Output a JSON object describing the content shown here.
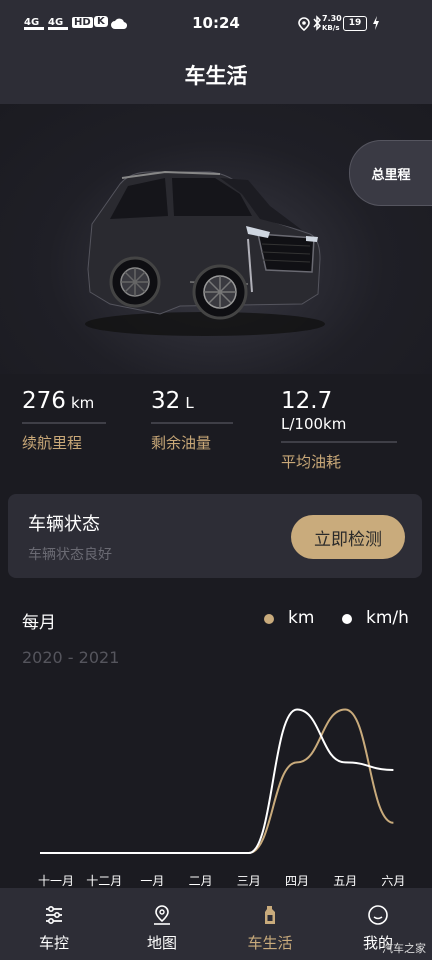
{
  "status_bar": {
    "time": "10:24",
    "net_speed": "7.30",
    "net_speed_unit": "KB/s",
    "battery": "19",
    "signal1": "4G",
    "signal2": "4G",
    "hd": "HD",
    "k_label": "K"
  },
  "header": {
    "title": "车生活"
  },
  "hero": {
    "odometer_label": "总里程"
  },
  "stats": [
    {
      "value": "276",
      "unit": "km",
      "label": "续航里程"
    },
    {
      "value": "32",
      "unit": "L",
      "label": "剩余油量"
    },
    {
      "value": "12.7",
      "unit": "L/100km",
      "label": "平均油耗"
    }
  ],
  "vehicle_status": {
    "title": "车辆状态",
    "subtitle": "车辆状态良好",
    "button": "立即检测"
  },
  "chart_section": {
    "period": "每月",
    "years": "2020 - 2021",
    "legend": [
      {
        "label": "km",
        "color": "#c9ab7c"
      },
      {
        "label": "km/h",
        "color": "#ffffff"
      }
    ]
  },
  "chart_data": {
    "type": "line",
    "categories": [
      "十一月",
      "十二月",
      "一月",
      "二月",
      "三月",
      "四月",
      "五月",
      "六月"
    ],
    "series": [
      {
        "name": "km",
        "color": "#c9ab7c",
        "values": [
          0,
          0,
          0,
          0,
          0,
          0.6,
          0.95,
          0.2
        ]
      },
      {
        "name": "km/h",
        "color": "#ffffff",
        "values": [
          0,
          0,
          0,
          0,
          0,
          0.95,
          0.6,
          0.55
        ]
      }
    ]
  },
  "nav": [
    {
      "label": "车控",
      "icon": "sliders-icon",
      "active": false
    },
    {
      "label": "地图",
      "icon": "map-pin-icon",
      "active": false
    },
    {
      "label": "车生活",
      "icon": "fuel-bottle-icon",
      "active": true
    },
    {
      "label": "我的",
      "icon": "smiley-icon",
      "active": false
    }
  ],
  "colors": {
    "accent": "#c9ab7c",
    "bg": "#1b1b21",
    "card": "#2d2d36"
  },
  "watermark": "汽车之家"
}
